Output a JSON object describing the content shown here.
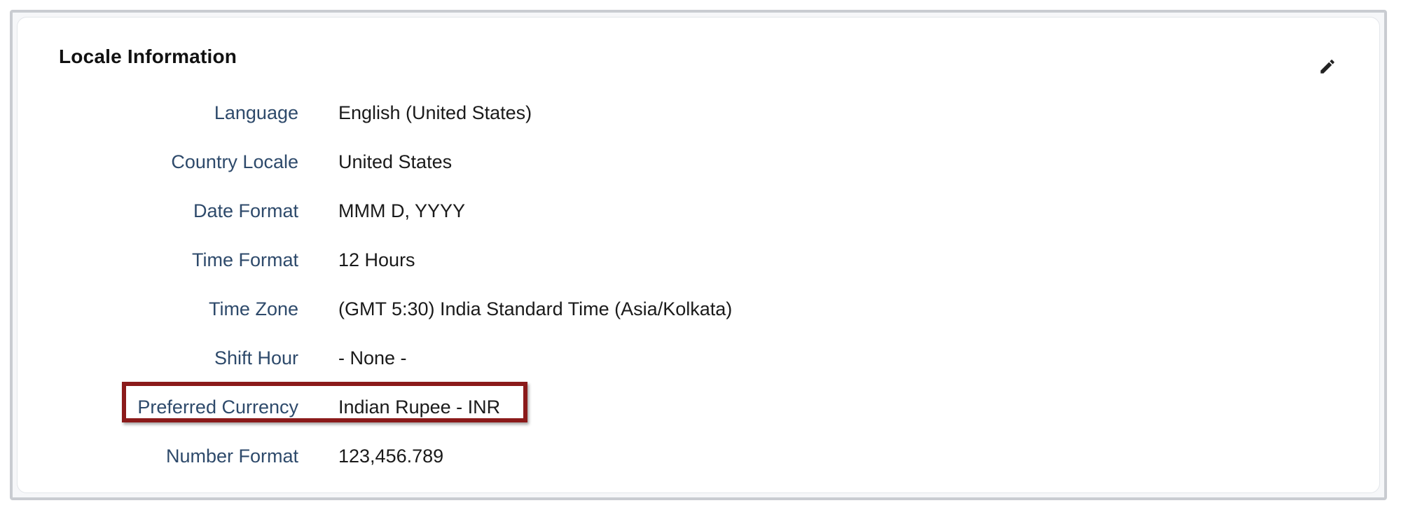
{
  "section": {
    "title": "Locale Information",
    "edit_icon": "pencil-icon"
  },
  "fields": [
    {
      "label": "Language",
      "value": "English (United States)"
    },
    {
      "label": "Country Locale",
      "value": "United States"
    },
    {
      "label": "Date Format",
      "value": "MMM D, YYYY"
    },
    {
      "label": "Time Format",
      "value": "12 Hours"
    },
    {
      "label": "Time Zone",
      "value": "(GMT 5:30) India Standard Time (Asia/Kolkata)"
    },
    {
      "label": "Shift Hour",
      "value": "- None -"
    },
    {
      "label": "Preferred Currency",
      "value": "Indian Rupee - INR"
    },
    {
      "label": "Number Format",
      "value": "123,456.789"
    }
  ],
  "highlight": {
    "target": "Preferred Currency",
    "color": "#8b1a1a"
  },
  "colors": {
    "label": "#2e4a6b",
    "value": "#1a1a1a",
    "title": "#111111"
  }
}
